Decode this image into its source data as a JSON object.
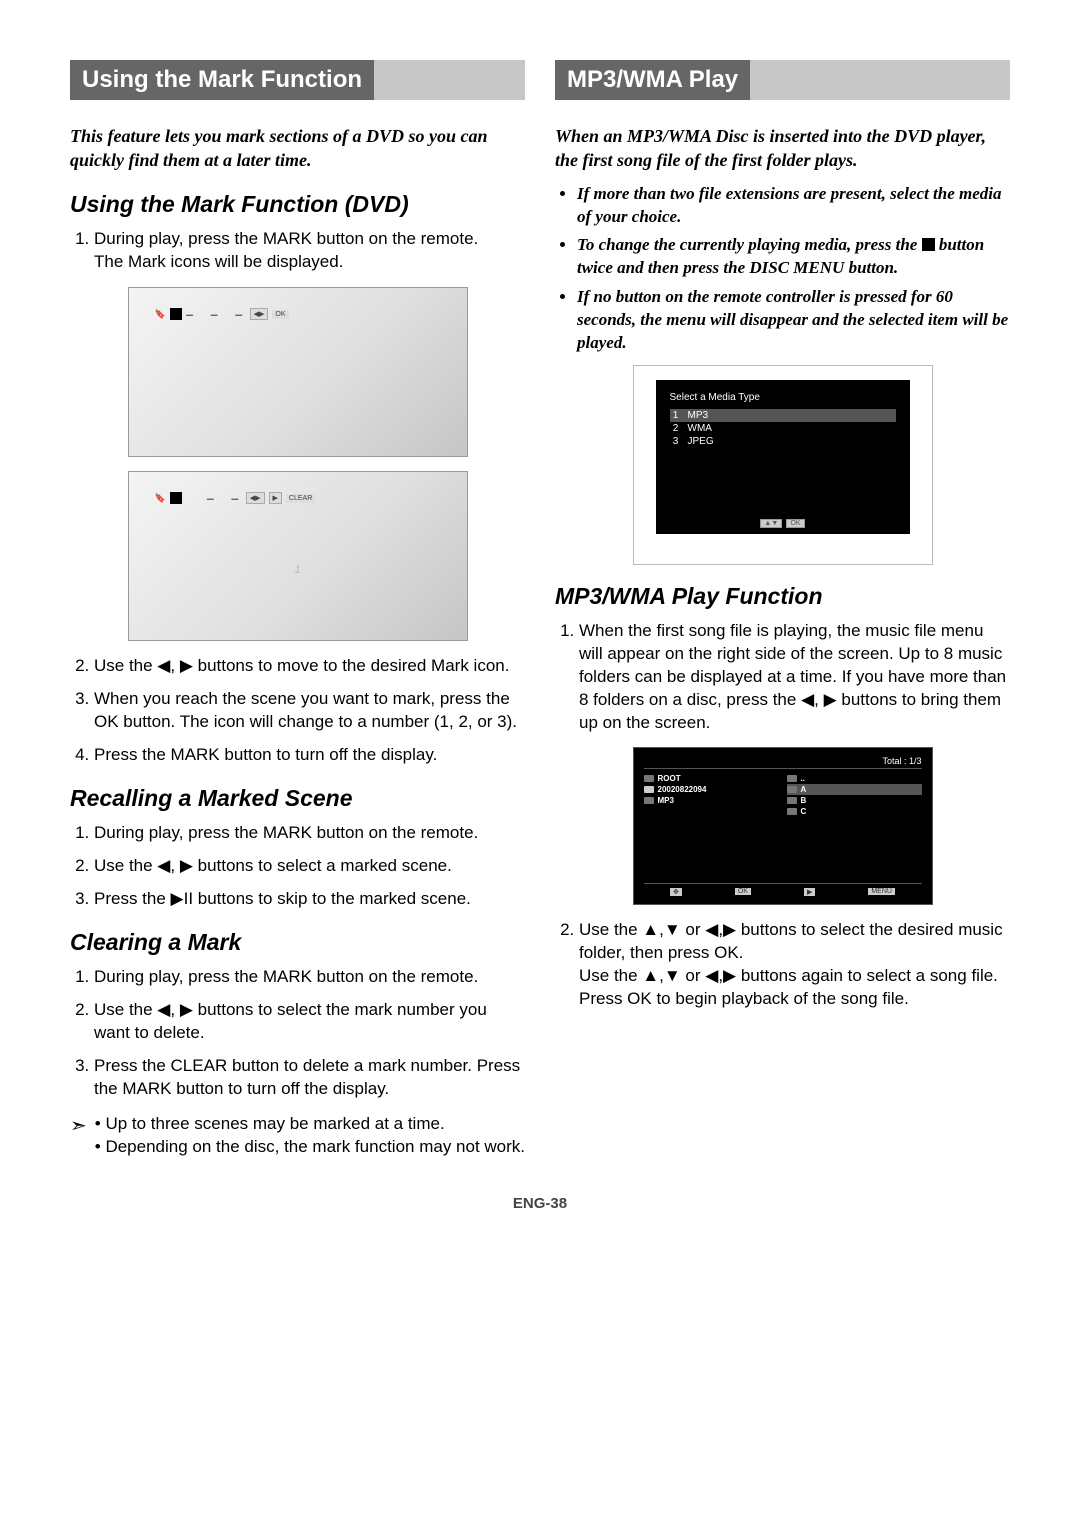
{
  "left": {
    "banner": "Using the Mark Function",
    "lead": "This feature lets you mark sections of a DVD so you can quickly find them at a later time.",
    "h_using": "Using the Mark Function (DVD)",
    "steps_using": {
      "s1a": "During play, press the MARK button on the remote.",
      "s1b": "The Mark icons will be displayed.",
      "s2": "Use the ◀, ▶ buttons to move to the desired Mark icon.",
      "s3": "When you reach the scene you want to mark, press the OK button. The icon will change to a number (1, 2, or 3).",
      "s4": "Press the MARK button to turn off the display."
    },
    "h_recall": "Recalling a Marked Scene",
    "steps_recall": {
      "s1": "During play, press the MARK button on the remote.",
      "s2": "Use the ◀, ▶ buttons to select a marked scene.",
      "s3": "Press the ▶II buttons to skip to the marked scene."
    },
    "h_clear": "Clearing a Mark",
    "steps_clear": {
      "s1": "During play, press the MARK button on the remote.",
      "s2": "Use the ◀, ▶ buttons to select the mark number you want to delete.",
      "s3": "Press the CLEAR button to delete a mark number. Press the MARK button to turn off the display."
    },
    "notes": {
      "n1": "Up to three scenes may be marked at a time.",
      "n2": "Depending on the disc, the mark function may not work."
    },
    "tv1": {
      "ok": "OK"
    },
    "tv2": {
      "clear": "CLEAR",
      "one": "1"
    }
  },
  "right": {
    "banner": "MP3/WMA Play",
    "lead": "When an MP3/WMA Disc is inserted into the DVD player, the first song file of the first folder plays.",
    "bullets": {
      "b1": "If more than two file extensions are present, select the media of your choice.",
      "b2_pre": "To change the currently playing media, press the ",
      "b2_post": " button twice and then press the DISC MENU button.",
      "b3": "If no button on the remote controller is pressed for 60 seconds, the menu will disappear and the selected item will be played."
    },
    "media": {
      "title": "Select a Media Type",
      "r1n": "1",
      "r1l": "MP3",
      "r2n": "2",
      "r2l": "WMA",
      "r3n": "3",
      "r3l": "JPEG",
      "ok": "OK"
    },
    "h_func": "MP3/WMA Play Function",
    "steps_func": {
      "s1": "When the first song file is playing, the music file menu will appear on the right side of the screen. Up to 8 music folders can be displayed at a time. If you have more than 8 folders on a disc, press the ◀, ▶ buttons to bring them up on the screen.",
      "s2a": "Use the ▲,▼ or ◀,▶ buttons to select the desired music folder, then press OK.",
      "s2b": "Use the ▲,▼ or ◀,▶ buttons again to select a song file.",
      "s2c": "Press OK to begin playback of the song file."
    },
    "browser": {
      "total": "Total : 1/3",
      "root": "ROOT",
      "code": "20020822094",
      "mp3": "MP3",
      "dotdot": "..",
      "a": "A",
      "b": "B",
      "c": "C",
      "ok": "OK",
      "menu": "MENU"
    }
  },
  "pagenum": "ENG-38"
}
